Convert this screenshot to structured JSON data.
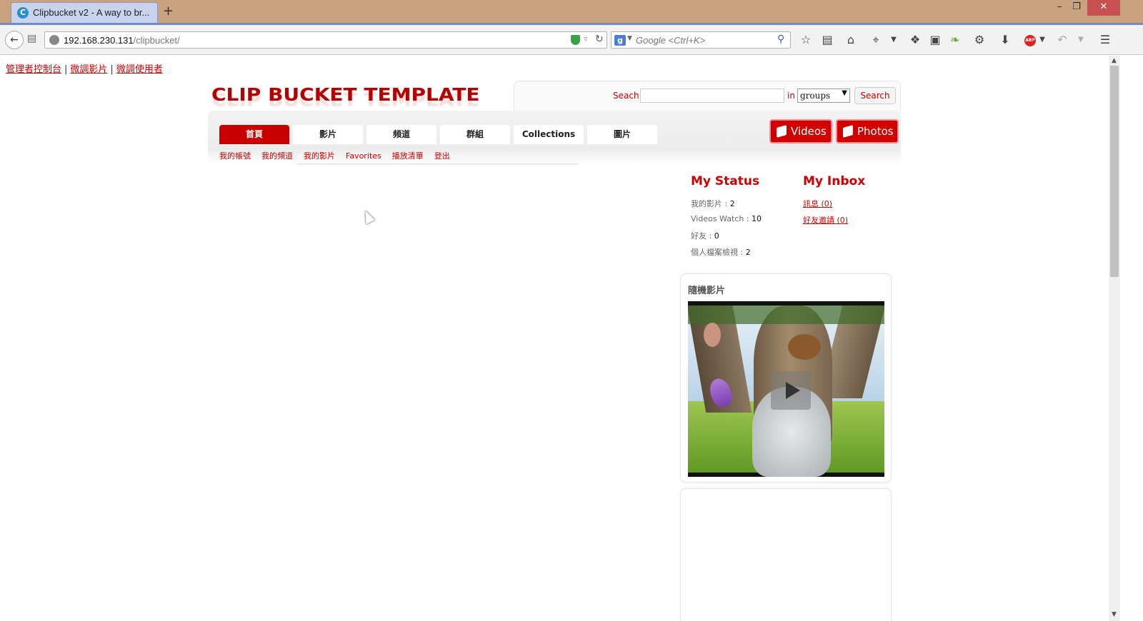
{
  "browser": {
    "tab_title": "Clipbucket v2 - A way to br...",
    "tab_favicon": "C",
    "new_tab": "+",
    "window_controls": {
      "minimize": "–",
      "maximize": "❐",
      "close": "✕"
    },
    "url_host": "192.168.230.131",
    "url_path": "/clipbucket/",
    "search_engine": "g",
    "search_placeholder": "Google <Ctrl+K>",
    "toolbar_icons": [
      "bookmark-star-icon",
      "reading-list-icon",
      "home-icon",
      "crop-icon",
      "dropdown-icon",
      "extension-icon",
      "screenshot-icon",
      "leaf-icon",
      "puzzle-icon",
      "download-icon",
      "adblock-icon",
      "undo-icon",
      "dropdown-icon",
      "menu-icon"
    ],
    "adblock_label": "ABP"
  },
  "admin_links": [
    {
      "label": "管理者控制台"
    },
    {
      "label": "微調影片"
    },
    {
      "label": "微調使用者"
    }
  ],
  "admin_sep": "|",
  "logo_text": "CLIP BUCKET TEMPLATE",
  "search": {
    "label": "Seach",
    "value": "",
    "in_label": "in",
    "selected": "groups",
    "button": "Search"
  },
  "nav_tabs": [
    {
      "label": "首頁",
      "active": true
    },
    {
      "label": "影片",
      "active": false
    },
    {
      "label": "頻道",
      "active": false
    },
    {
      "label": "群組",
      "active": false
    },
    {
      "label": "Collections",
      "active": false
    },
    {
      "label": "圖片",
      "active": false
    }
  ],
  "big_buttons": {
    "videos": "Videos",
    "photos": "Photos"
  },
  "sub_nav": [
    "我的帳號",
    "我的頻道",
    "我的影片",
    "Favorites",
    "播放清單",
    "登出"
  ],
  "my_status": {
    "title": "My Status",
    "lines": [
      {
        "label": "我的影片 : ",
        "value": "2"
      },
      {
        "label": "Videos Watch : ",
        "value": "10"
      },
      {
        "label": "好友 : ",
        "value": "0"
      },
      {
        "label": "個人檔案檢視 : ",
        "value": "2"
      }
    ]
  },
  "my_inbox": {
    "title": "My Inbox",
    "links": [
      "訊息 (0)",
      "好友邀請 (0)"
    ]
  },
  "random_video": {
    "title": "隨機影片"
  },
  "colors": {
    "brand_red": "#c00000",
    "titlebar": "#c9a37f",
    "tab": "#c8d3ee"
  }
}
